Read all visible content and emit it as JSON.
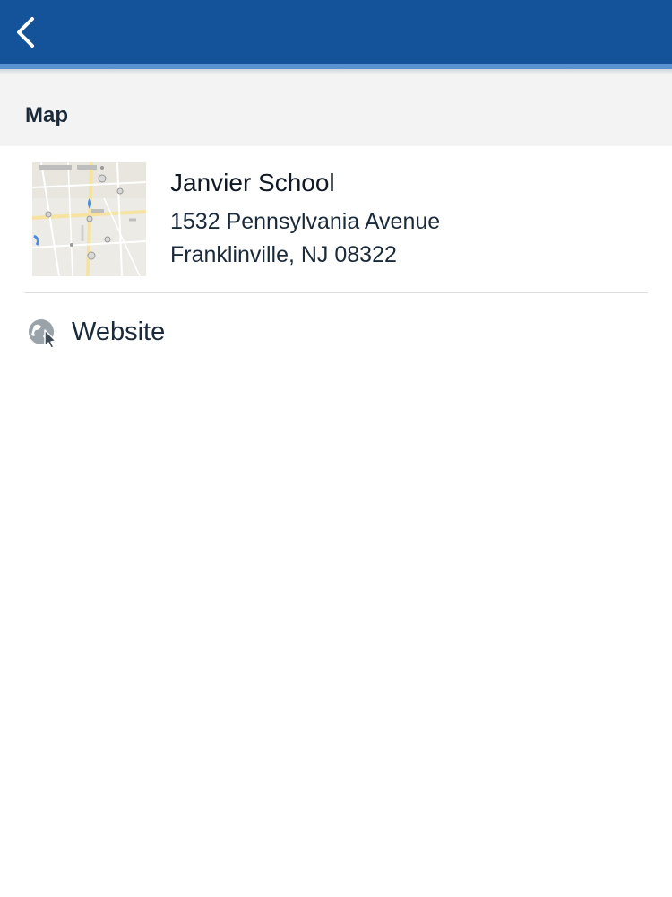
{
  "nav": {
    "back_icon": "chevron-left-icon",
    "colors": {
      "bar": "#14529a",
      "accent": "#5a93cf"
    }
  },
  "section": {
    "title": "Map"
  },
  "location": {
    "name": "Janvier School",
    "address_line1": "1532 Pennsylvania Avenue",
    "address_line2": "Franklinville, NJ 08322",
    "map_icon": "map-thumbnail"
  },
  "website": {
    "label": "Website",
    "icon": "globe-cursor-icon"
  }
}
